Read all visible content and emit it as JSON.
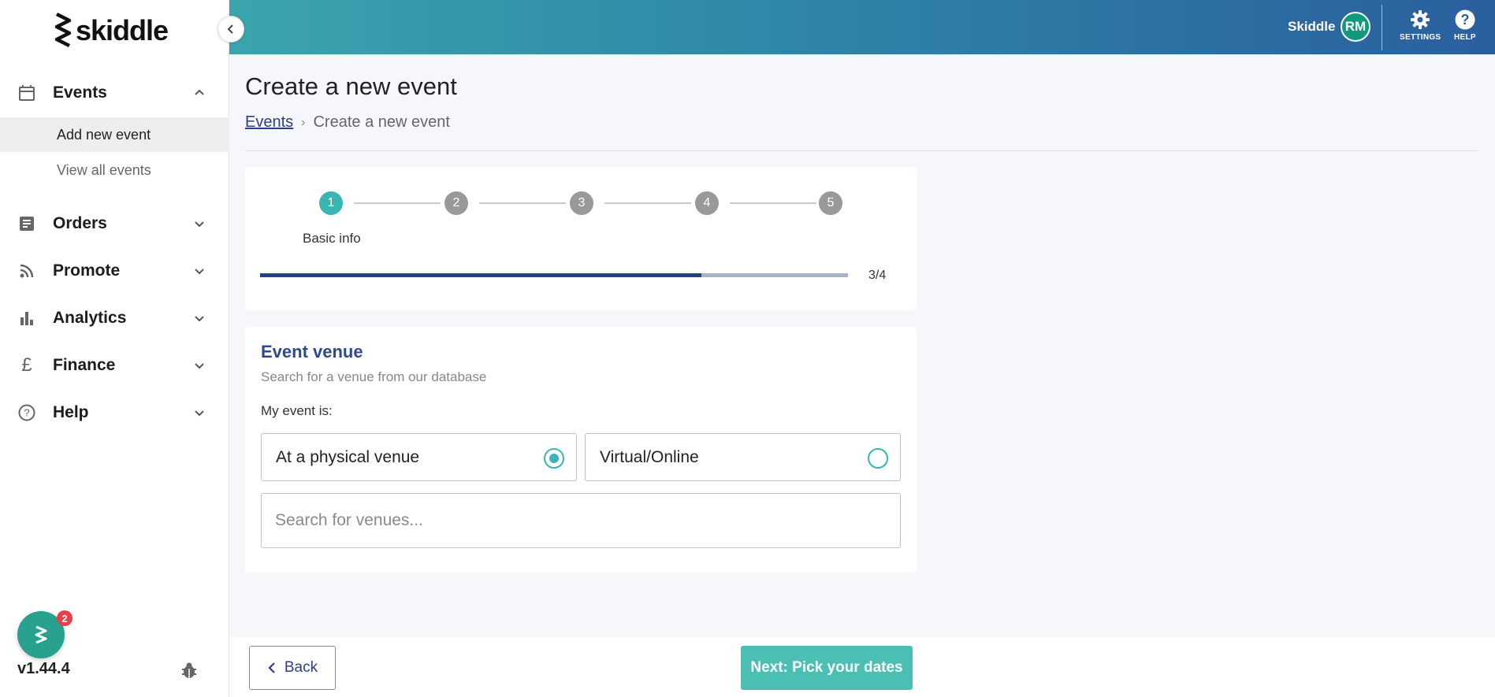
{
  "app": {
    "brand": "skiddle",
    "version": "v1.44.4",
    "notification_count": "2"
  },
  "header": {
    "user_name": "Skiddle",
    "avatar_initials": "RM",
    "settings_label": "SETTINGS",
    "help_label": "HELP"
  },
  "sidebar": {
    "items": [
      {
        "label": "Events",
        "icon": "calendar-icon",
        "expanded": true
      },
      {
        "label": "Orders",
        "icon": "receipt-icon",
        "expanded": false
      },
      {
        "label": "Promote",
        "icon": "rss-icon",
        "expanded": false
      },
      {
        "label": "Analytics",
        "icon": "bar-chart-icon",
        "expanded": false
      },
      {
        "label": "Finance",
        "icon": "pound-icon",
        "expanded": false
      },
      {
        "label": "Help",
        "icon": "question-circle-icon",
        "expanded": false
      }
    ],
    "events_subitems": [
      {
        "label": "Add new event",
        "active": true
      },
      {
        "label": "View all events",
        "active": false
      }
    ]
  },
  "page": {
    "title": "Create a new event",
    "breadcrumb": {
      "link": "Events",
      "separator": "›",
      "current": "Create a new event"
    }
  },
  "stepper": {
    "steps": [
      "1",
      "2",
      "3",
      "4",
      "5"
    ],
    "current_step_label": "Basic info",
    "progress_text": "3/4",
    "progress_fraction": 0.75
  },
  "venue": {
    "title": "Event venue",
    "subtitle": "Search for a venue from our database",
    "question": "My event is:",
    "options": [
      {
        "label": "At a physical venue",
        "selected": true
      },
      {
        "label": "Virtual/Online",
        "selected": false
      }
    ],
    "search_placeholder": "Search for venues..."
  },
  "footer": {
    "back_label": "Back",
    "next_label": "Next: Pick your dates"
  },
  "colors": {
    "accent_teal": "#3bb5b3",
    "next_button": "#4cbfb4",
    "progress_fill": "#23418a",
    "step_inactive": "#999999",
    "link": "#2c3e8c"
  }
}
